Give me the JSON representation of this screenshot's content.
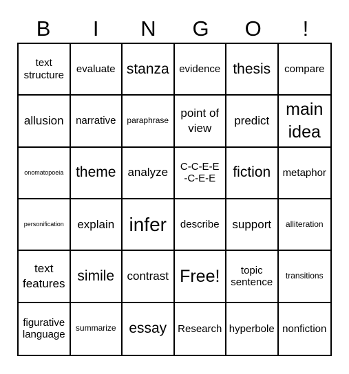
{
  "header": {
    "letters": [
      "B",
      "I",
      "N",
      "G",
      "O",
      "!"
    ]
  },
  "board": {
    "rows": [
      [
        "text structure",
        "evaluate",
        "stanza",
        "evidence",
        "thesis",
        "compare"
      ],
      [
        "allusion",
        "narrative",
        "paraphrase",
        "point of view",
        "predict",
        "main idea"
      ],
      [
        "onomatopoeia",
        "theme",
        "analyze",
        "C-C-E-E-C-E-E",
        "fiction",
        "metaphor"
      ],
      [
        "personification",
        "explain",
        "infer",
        "describe",
        "support",
        "alliteration"
      ],
      [
        "text features",
        "simile",
        "contrast",
        "Free!",
        "topic sentence",
        "transitions"
      ],
      [
        "figurative language",
        "summarize",
        "essay",
        "Research",
        "hyperbole",
        "nonfiction"
      ]
    ]
  }
}
